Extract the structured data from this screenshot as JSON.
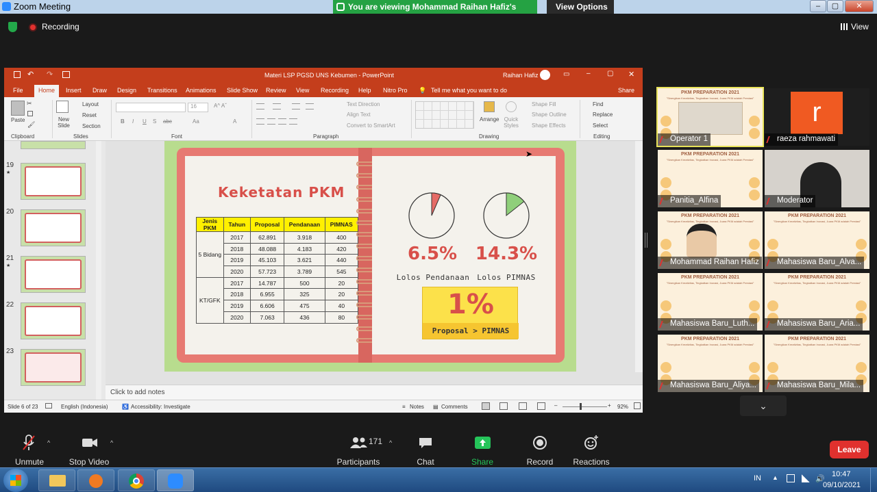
{
  "zoom": {
    "window_title": "Zoom Meeting",
    "viewing_banner": "You are viewing Mohammad Raihan Hafiz's screen",
    "view_options": "View Options",
    "recording": "Recording",
    "view": "View",
    "controls": [
      {
        "label": "Unmute",
        "icon": "mic-muted-icon"
      },
      {
        "label": "Stop Video",
        "icon": "video-camera-icon"
      },
      {
        "label": "Participants",
        "icon": "participants-icon",
        "count": "171"
      },
      {
        "label": "Chat",
        "icon": "chat-icon"
      },
      {
        "label": "Share Screen",
        "icon": "share-screen-icon"
      },
      {
        "label": "Record",
        "icon": "record-icon"
      },
      {
        "label": "Reactions",
        "icon": "reactions-icon"
      }
    ],
    "leave": "Leave",
    "accent_green": "#25a243",
    "leave_red": "#e0312e"
  },
  "ppt": {
    "title": "Materi LSP PGSD UNS Kebumen - PowerPoint",
    "user": "Raihan Hafiz",
    "menu": [
      "File",
      "Home",
      "Insert",
      "Draw",
      "Design",
      "Transitions",
      "Animations",
      "Slide Show",
      "Review",
      "View",
      "Recording",
      "Help",
      "Nitro Pro"
    ],
    "tell_me": "Tell me what you want to do",
    "share": "Share",
    "ribbon": {
      "paste": "Paste",
      "new_slide": "New Slide",
      "layout": "Layout",
      "reset": "Reset",
      "section": "Section",
      "font_size": "16",
      "text_direction": "Text Direction",
      "align_text": "Align Text",
      "convert_smartart": "Convert to SmartArt",
      "arrange": "Arrange",
      "quick_styles": "Quick Styles",
      "shape_fill": "Shape Fill",
      "shape_outline": "Shape Outline",
      "shape_effects": "Shape Effects",
      "find": "Find",
      "replace": "Replace",
      "select": "Select",
      "groups": [
        "Clipboard",
        "Slides",
        "Font",
        "Paragraph",
        "Drawing",
        "Editing"
      ]
    },
    "thumbnails": [
      {
        "num": "19",
        "star": "★"
      },
      {
        "num": "20",
        "star": ""
      },
      {
        "num": "21",
        "star": "★"
      },
      {
        "num": "22",
        "star": ""
      },
      {
        "num": "23",
        "star": ""
      }
    ],
    "slide": {
      "title": "Keketatan PKM",
      "table_headers": [
        "Jenis PKM",
        "Tahun",
        "Proposal",
        "Pendanaan",
        "PIMNAS"
      ],
      "groups": [
        "5 Bidang",
        "KT/GFK"
      ],
      "rows": [
        [
          "2017",
          "62.891",
          "3.918",
          "400"
        ],
        [
          "2018",
          "48.088",
          "4.183",
          "420"
        ],
        [
          "2019",
          "45.103",
          "3.621",
          "440"
        ],
        [
          "2020",
          "57.723",
          "3.789",
          "545"
        ],
        [
          "2017",
          "14.787",
          "500",
          "20"
        ],
        [
          "2018",
          "6.955",
          "325",
          "20"
        ],
        [
          "2019",
          "6.606",
          "475",
          "40"
        ],
        [
          "2020",
          "7.063",
          "436",
          "80"
        ]
      ],
      "stat1": {
        "value": "6.5%",
        "label": "Lolos Pendanaan",
        "fraction": 0.065,
        "color": "#e56b66"
      },
      "stat2": {
        "value": "14.3%",
        "label": "Lolos PIMNAS",
        "fraction": 0.143,
        "color": "#8fcf7a"
      },
      "highlight": {
        "value": "1%",
        "label": "Proposal > PIMNAS"
      }
    },
    "notes_placeholder": "Click to add notes",
    "status": {
      "slide": "Slide 6 of 23",
      "language": "English (Indonesia)",
      "accessibility": "Accessibility: Investigate",
      "notes": "Notes",
      "comments": "Comments",
      "zoom": "92%"
    }
  },
  "gallery": {
    "banner": "PKM PREPARATION 2021",
    "tagline": "\"Sinergikan Kreativitas, Tingkatkan Inovasi, Juara PKM adalah Prestasi\"",
    "avatar_letter": "r",
    "participants": [
      {
        "name": "Operator 1",
        "type": "video"
      },
      {
        "name": "raeza rahmawati",
        "type": "avatar"
      },
      {
        "name": "Panitia_Alfina",
        "type": "banner"
      },
      {
        "name": "Moderator",
        "type": "video"
      },
      {
        "name": "Mohammad Raihan Hafiz",
        "type": "video"
      },
      {
        "name": "Mahasiswa Baru_Alva...",
        "type": "banner"
      },
      {
        "name": "Mahasiswa Baru_Luth...",
        "type": "banner"
      },
      {
        "name": "Mahasiswa Baru_Aria...",
        "type": "banner"
      },
      {
        "name": "Mahasiswa Baru_Aliya...",
        "type": "banner"
      },
      {
        "name": "Mahasiswa Baru_Mila...",
        "type": "banner"
      }
    ]
  },
  "taskbar": {
    "lang": "IN",
    "time": "10:47",
    "date": "09/10/2021"
  }
}
